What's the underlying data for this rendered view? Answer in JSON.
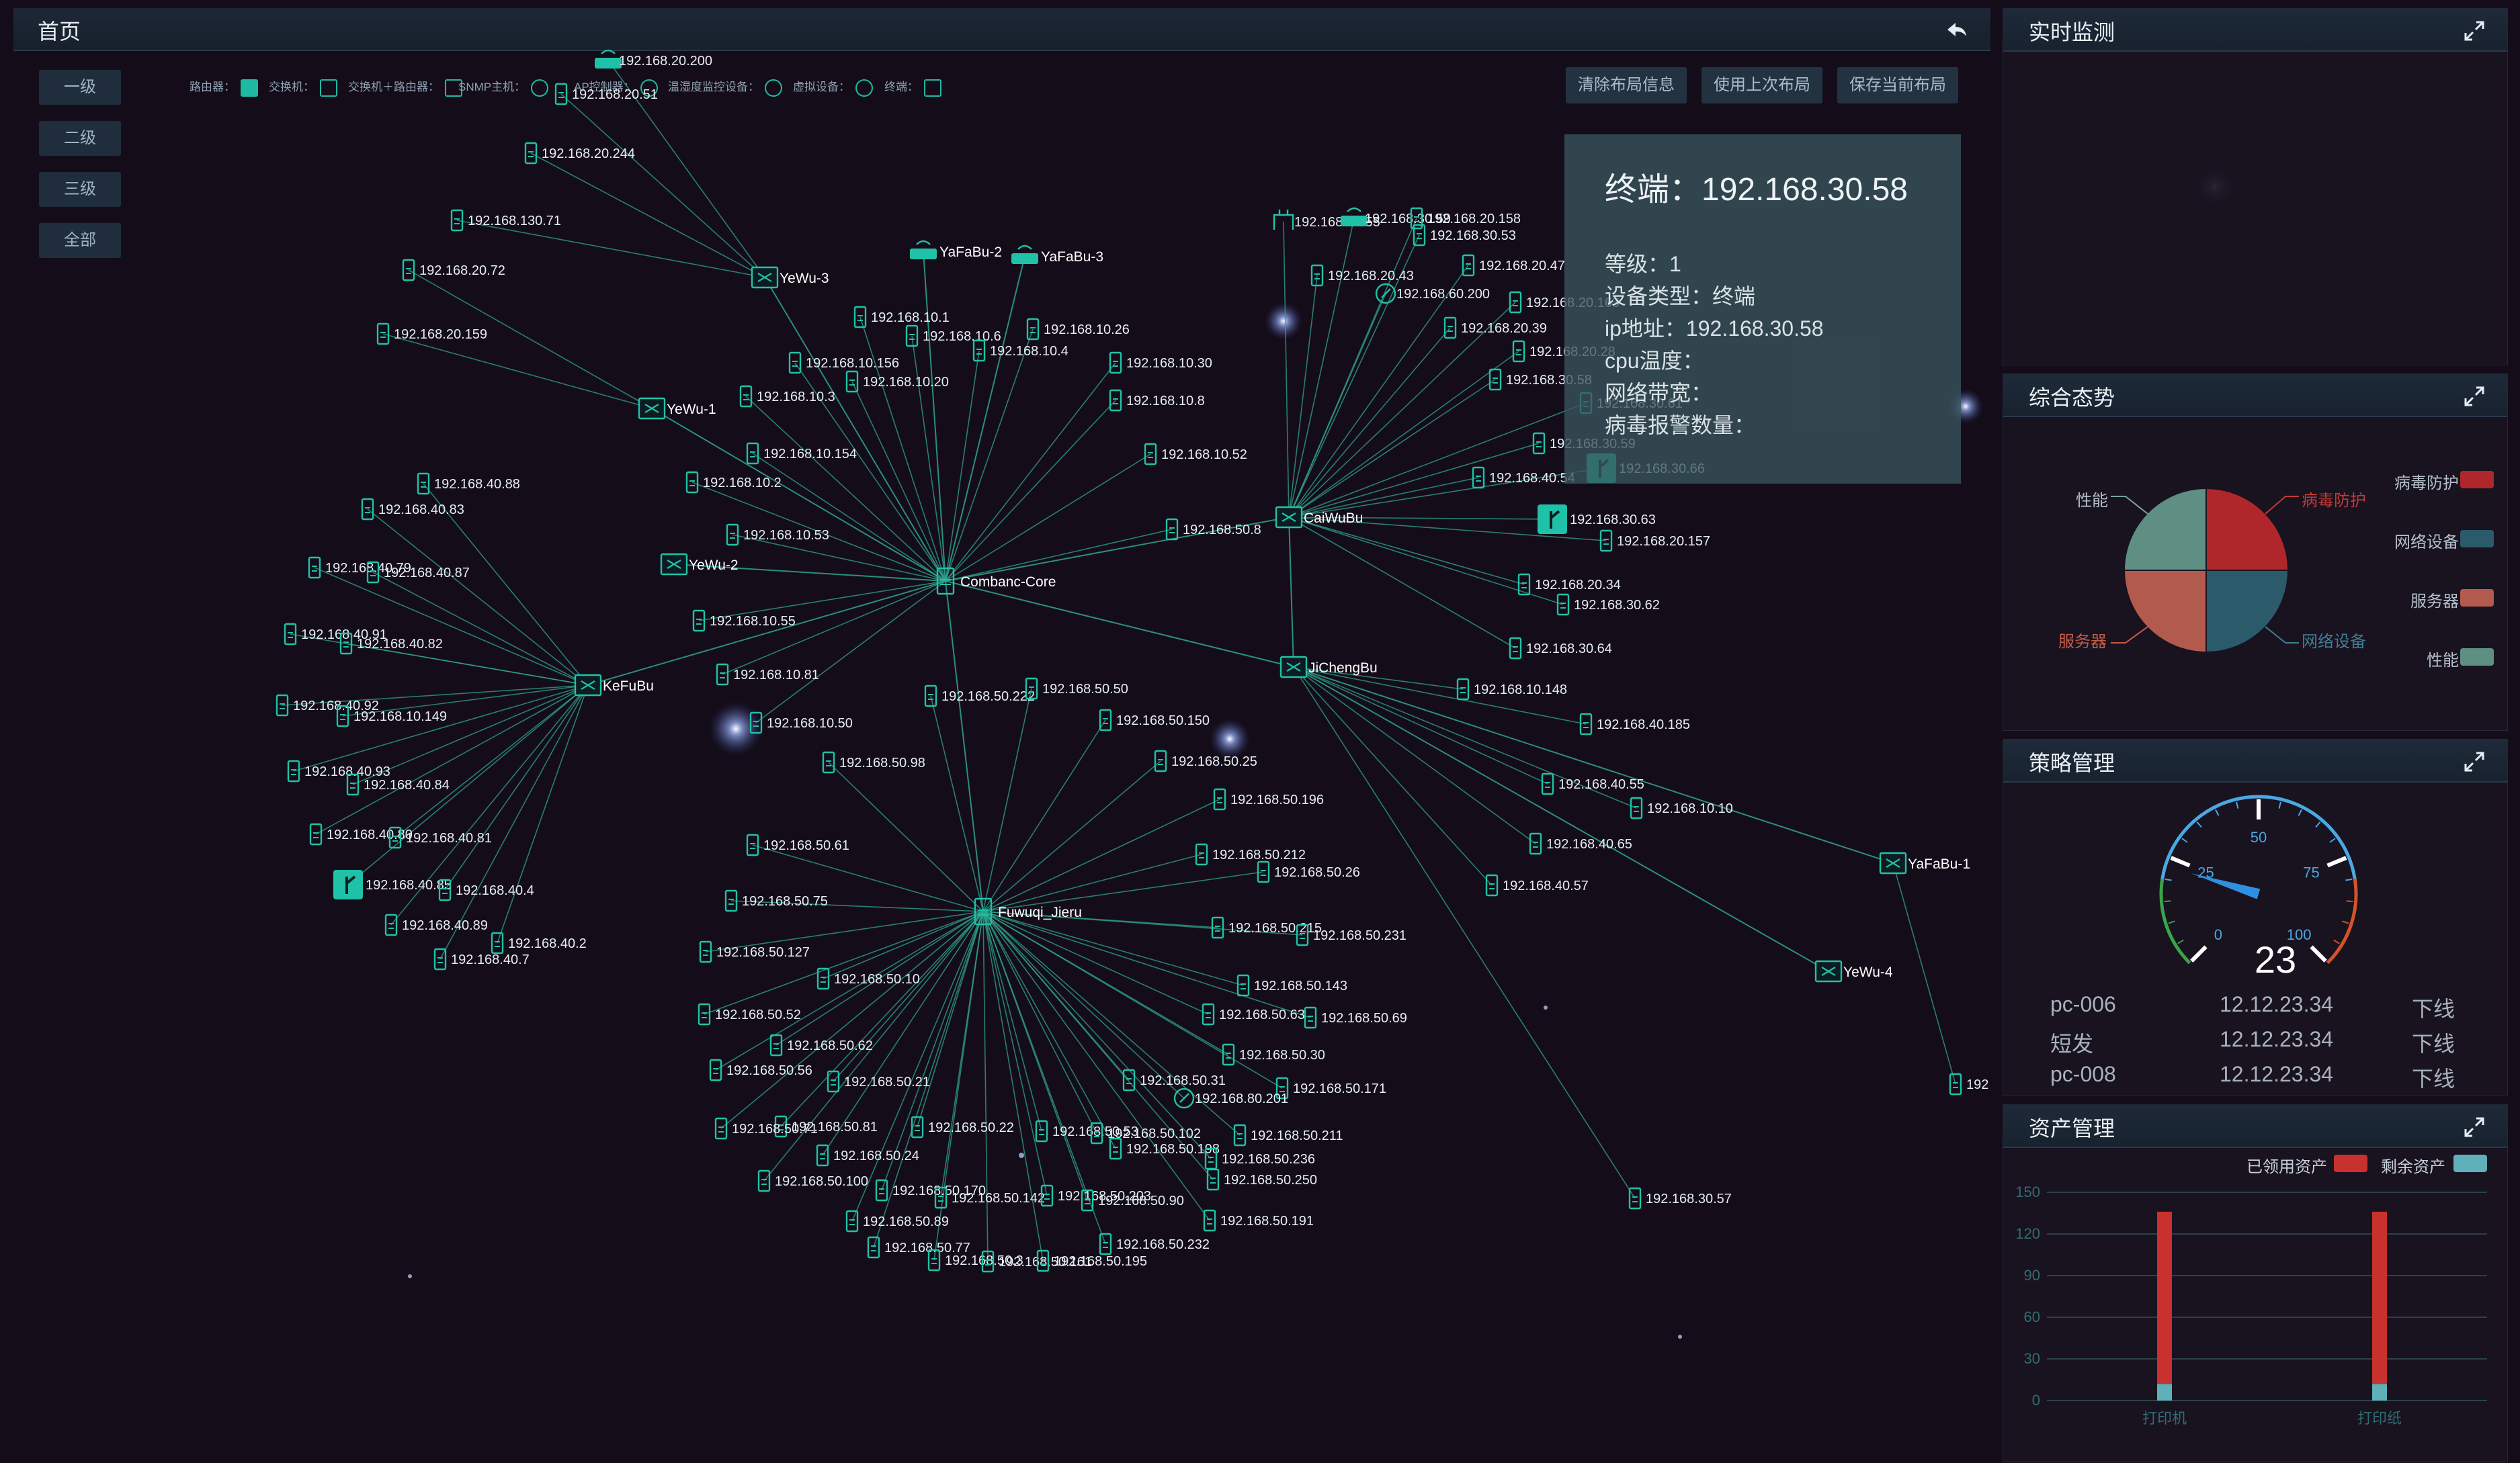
{
  "main": {
    "title": "首页",
    "levels": [
      "一级",
      "二级",
      "三级",
      "全部"
    ],
    "legend": [
      {
        "label": "路由器：",
        "icon": "router-icon"
      },
      {
        "label": "交换机：",
        "icon": "switch-icon"
      },
      {
        "label": "交换机＋路由器：",
        "icon": "switch-router-icon"
      },
      {
        "label": "SNMP主机：",
        "icon": "snmp-host-icon"
      },
      {
        "label": "AP控制器：",
        "icon": "ap-controller-icon"
      },
      {
        "label": "温湿度监控设备：",
        "icon": "thermo-monitor-icon"
      },
      {
        "label": "虚拟设备：",
        "icon": "virtual-device-icon"
      },
      {
        "label": "终端：",
        "icon": "terminal-icon"
      }
    ],
    "toolbar": {
      "clear_layout": "清除布局信息",
      "use_last_layout": "使用上次布局",
      "save_layout": "保存当前布局"
    },
    "tooltip": {
      "title": "终端：192.168.30.58",
      "level_label": "等级：",
      "level_value": "1",
      "type_label": "设备类型：",
      "type_value": "终端",
      "ip_label": "ip地址：",
      "ip_value": "192.168.30.58",
      "cpu_label": "cpu温度：",
      "bandwidth_label": "网络带宽：",
      "virus_label": "病毒报警数量："
    }
  },
  "topology": {
    "hubs": [
      {
        "id": "combanc",
        "label": "Combanc-Core",
        "kind": "server"
      },
      {
        "id": "fuwuqi",
        "label": "Fuwuqi_Jieru",
        "kind": "server"
      },
      {
        "id": "kefubu",
        "label": "KeFuBu",
        "kind": "switch"
      },
      {
        "id": "caiwubu",
        "label": "CaiWuBu",
        "kind": "switch"
      },
      {
        "id": "jichengbu",
        "label": "JiChengBu",
        "kind": "switch"
      },
      {
        "id": "yewu3",
        "label": "YeWu-3",
        "kind": "switch"
      },
      {
        "id": "yewu1",
        "label": "YeWu-1",
        "kind": "switch"
      },
      {
        "id": "yewu2",
        "label": "YeWu-2",
        "kind": "switch"
      },
      {
        "id": "yewu4",
        "label": "YeWu-4",
        "kind": "switch"
      },
      {
        "id": "yafabu1",
        "label": "YaFaBu-1",
        "kind": "switch"
      },
      {
        "id": "yafabu2",
        "label": "YaFaBu-2",
        "kind": "ap"
      },
      {
        "id": "yafabu3",
        "label": "YaFaBu-3",
        "kind": "ap"
      }
    ],
    "hub_links": [
      [
        "combanc",
        "fuwuqi"
      ],
      [
        "combanc",
        "kefubu"
      ],
      [
        "combanc",
        "caiwubu"
      ],
      [
        "combanc",
        "jichengbu"
      ],
      [
        "combanc",
        "yewu3"
      ],
      [
        "combanc",
        "yewu1"
      ],
      [
        "combanc",
        "yewu2"
      ],
      [
        "combanc",
        "yafabu2"
      ],
      [
        "combanc",
        "yafabu3"
      ],
      [
        "caiwubu",
        "jichengbu"
      ],
      [
        "jichengbu",
        "yafabu1"
      ],
      [
        "jichengbu",
        "yewu4"
      ]
    ],
    "nodes": [
      {
        "label": "192.168.20.200",
        "hub": "yewu3",
        "kind": "ap"
      },
      {
        "label": "192.168.20.51",
        "hub": "yewu3",
        "kind": "terminal"
      },
      {
        "label": "192.168.20.244",
        "hub": "yewu3",
        "kind": "terminal"
      },
      {
        "label": "192.168.130.71",
        "hub": "yewu3",
        "kind": "terminal"
      },
      {
        "label": "192.168.20.72",
        "hub": "yewu1",
        "kind": "terminal"
      },
      {
        "label": "192.168.20.159",
        "hub": "yewu1",
        "kind": "terminal"
      },
      {
        "label": "192.168.10.1",
        "hub": "combanc",
        "kind": "terminal"
      },
      {
        "label": "192.168.10.6",
        "hub": "combanc",
        "kind": "terminal"
      },
      {
        "label": "192.168.10.26",
        "hub": "combanc",
        "kind": "terminal"
      },
      {
        "label": "192.168.10.4",
        "hub": "combanc",
        "kind": "terminal"
      },
      {
        "label": "192.168.10.156",
        "hub": "combanc",
        "kind": "terminal"
      },
      {
        "label": "192.168.10.30",
        "hub": "combanc",
        "kind": "terminal"
      },
      {
        "label": "192.168.10.20",
        "hub": "combanc",
        "kind": "terminal"
      },
      {
        "label": "192.168.10.3",
        "hub": "combanc",
        "kind": "terminal"
      },
      {
        "label": "192.168.10.8",
        "hub": "combanc",
        "kind": "terminal"
      },
      {
        "label": "192.168.10.154",
        "hub": "combanc",
        "kind": "terminal"
      },
      {
        "label": "192.168.10.52",
        "hub": "combanc",
        "kind": "terminal"
      },
      {
        "label": "192.168.10.2",
        "hub": "combanc",
        "kind": "terminal"
      },
      {
        "label": "192.168.10.53",
        "hub": "combanc",
        "kind": "terminal"
      },
      {
        "label": "192.168.50.8",
        "hub": "combanc",
        "kind": "terminal"
      },
      {
        "label": "192.168.10.55",
        "hub": "combanc",
        "kind": "terminal"
      },
      {
        "label": "192.168.10.81",
        "hub": "combanc",
        "kind": "terminal"
      },
      {
        "label": "192.168.10.50",
        "hub": "combanc",
        "kind": "terminal"
      },
      {
        "label": "192.168.40.88",
        "hub": "kefubu",
        "kind": "terminal"
      },
      {
        "label": "192.168.40.83",
        "hub": "kefubu",
        "kind": "terminal"
      },
      {
        "label": "192.168.40.79",
        "hub": "kefubu",
        "kind": "terminal"
      },
      {
        "label": "192.168.40.87",
        "hub": "kefubu",
        "kind": "terminal"
      },
      {
        "label": "192.168.40.91",
        "hub": "kefubu",
        "kind": "terminal"
      },
      {
        "label": "192.168.40.82",
        "hub": "kefubu",
        "kind": "terminal"
      },
      {
        "label": "192.168.40.92",
        "hub": "kefubu",
        "kind": "terminal"
      },
      {
        "label": "192.168.10.149",
        "hub": "kefubu",
        "kind": "terminal"
      },
      {
        "label": "192.168.40.93",
        "hub": "kefubu",
        "kind": "terminal"
      },
      {
        "label": "192.168.40.84",
        "hub": "kefubu",
        "kind": "terminal"
      },
      {
        "label": "192.168.40.80",
        "hub": "kefubu",
        "kind": "terminal"
      },
      {
        "label": "192.168.40.81",
        "hub": "kefubu",
        "kind": "terminal"
      },
      {
        "label": "192.168.40.85",
        "hub": "kefubu",
        "kind": "router"
      },
      {
        "label": "192.168.40.4",
        "hub": "kefubu",
        "kind": "terminal"
      },
      {
        "label": "192.168.40.89",
        "hub": "kefubu",
        "kind": "terminal"
      },
      {
        "label": "192.168.40.2",
        "hub": "kefubu",
        "kind": "terminal"
      },
      {
        "label": "192.168.40.7",
        "hub": "kefubu",
        "kind": "terminal"
      },
      {
        "label": "192.168.30.55",
        "hub": "caiwubu",
        "kind": "snmp"
      },
      {
        "label": "192.168.30.59",
        "hub": "caiwubu",
        "kind": "ap"
      },
      {
        "label": "192.168.20.158",
        "hub": "caiwubu",
        "kind": "terminal"
      },
      {
        "label": "192.168.30.53",
        "hub": "caiwubu",
        "kind": "terminal"
      },
      {
        "label": "192.168.20.43",
        "hub": "caiwubu",
        "kind": "terminal"
      },
      {
        "label": "192.168.20.47",
        "hub": "caiwubu",
        "kind": "terminal"
      },
      {
        "label": "192.168.60.200",
        "hub": "caiwubu",
        "kind": "virtual"
      },
      {
        "label": "192.168.20.163",
        "hub": "caiwubu",
        "kind": "terminal"
      },
      {
        "label": "192.168.20.39",
        "hub": "caiwubu",
        "kind": "terminal"
      },
      {
        "label": "192.168.20.28",
        "hub": "caiwubu",
        "kind": "terminal"
      },
      {
        "label": "192.168.30.58",
        "hub": "caiwubu",
        "kind": "terminal"
      },
      {
        "label": "192.168.30.61",
        "hub": "caiwubu",
        "kind": "terminal"
      },
      {
        "label": "192.168.30.59",
        "hub": "caiwubu",
        "kind": "terminal"
      },
      {
        "label": "192.168.40.54",
        "hub": "caiwubu",
        "kind": "terminal"
      },
      {
        "label": "192.168.30.66",
        "hub": "caiwubu",
        "kind": "router"
      },
      {
        "label": "192.168.30.63",
        "hub": "caiwubu",
        "kind": "router"
      },
      {
        "label": "192.168.20.157",
        "hub": "caiwubu",
        "kind": "terminal"
      },
      {
        "label": "192.168.20.34",
        "hub": "caiwubu",
        "kind": "terminal"
      },
      {
        "label": "192.168.30.62",
        "hub": "caiwubu",
        "kind": "terminal"
      },
      {
        "label": "192.168.30.64",
        "hub": "caiwubu",
        "kind": "terminal"
      },
      {
        "label": "192.168.10.148",
        "hub": "jichengbu",
        "kind": "terminal"
      },
      {
        "label": "192.168.40.185",
        "hub": "jichengbu",
        "kind": "terminal"
      },
      {
        "label": "192.168.40.55",
        "hub": "jichengbu",
        "kind": "terminal"
      },
      {
        "label": "192.168.10.10",
        "hub": "jichengbu",
        "kind": "terminal"
      },
      {
        "label": "192.168.40.65",
        "hub": "jichengbu",
        "kind": "terminal"
      },
      {
        "label": "192.168.40.57",
        "hub": "jichengbu",
        "kind": "terminal"
      },
      {
        "label": "192.168.30.57",
        "hub": "jichengbu",
        "kind": "terminal"
      },
      {
        "label": "192",
        "hub": "yafabu1",
        "kind": "terminal"
      },
      {
        "label": "192.168.50.222",
        "hub": "fuwuqi",
        "kind": "terminal"
      },
      {
        "label": "192.168.50.50",
        "hub": "fuwuqi",
        "kind": "terminal"
      },
      {
        "label": "192.168.50.150",
        "hub": "fuwuqi",
        "kind": "terminal"
      },
      {
        "label": "192.168.50.98",
        "hub": "fuwuqi",
        "kind": "terminal"
      },
      {
        "label": "192.168.50.25",
        "hub": "fuwuqi",
        "kind": "terminal"
      },
      {
        "label": "192.168.50.196",
        "hub": "fuwuqi",
        "kind": "terminal"
      },
      {
        "label": "192.168.50.61",
        "hub": "fuwuqi",
        "kind": "terminal"
      },
      {
        "label": "192.168.50.212",
        "hub": "fuwuqi",
        "kind": "terminal"
      },
      {
        "label": "192.168.50.26",
        "hub": "fuwuqi",
        "kind": "terminal"
      },
      {
        "label": "192.168.50.75",
        "hub": "fuwuqi",
        "kind": "terminal"
      },
      {
        "label": "192.168.50.215",
        "hub": "fuwuqi",
        "kind": "terminal"
      },
      {
        "label": "192.168.50.231",
        "hub": "fuwuqi",
        "kind": "terminal"
      },
      {
        "label": "192.168.50.127",
        "hub": "fuwuqi",
        "kind": "terminal"
      },
      {
        "label": "192.168.50.10",
        "hub": "fuwuqi",
        "kind": "terminal"
      },
      {
        "label": "192.168.50.143",
        "hub": "fuwuqi",
        "kind": "terminal"
      },
      {
        "label": "192.168.50.52",
        "hub": "fuwuqi",
        "kind": "terminal"
      },
      {
        "label": "192.168.50.63",
        "hub": "fuwuqi",
        "kind": "terminal"
      },
      {
        "label": "192.168.50.69",
        "hub": "fuwuqi",
        "kind": "terminal"
      },
      {
        "label": "192.168.50.62",
        "hub": "fuwuqi",
        "kind": "terminal"
      },
      {
        "label": "192.168.50.56",
        "hub": "fuwuqi",
        "kind": "terminal"
      },
      {
        "label": "192.168.50.30",
        "hub": "fuwuqi",
        "kind": "terminal"
      },
      {
        "label": "192.168.50.21",
        "hub": "fuwuqi",
        "kind": "terminal"
      },
      {
        "label": "192.168.50.31",
        "hub": "fuwuqi",
        "kind": "terminal"
      },
      {
        "label": "192.168.50.171",
        "hub": "fuwuqi",
        "kind": "terminal"
      },
      {
        "label": "192.168.80.201",
        "hub": "fuwuqi",
        "kind": "virtual"
      },
      {
        "label": "192.168.50.81",
        "hub": "fuwuqi",
        "kind": "terminal"
      },
      {
        "label": "192.168.50.71",
        "hub": "fuwuqi",
        "kind": "terminal"
      },
      {
        "label": "192.168.50.22",
        "hub": "fuwuqi",
        "kind": "terminal"
      },
      {
        "label": "192.168.50.53",
        "hub": "fuwuqi",
        "kind": "terminal"
      },
      {
        "label": "192.168.50.102",
        "hub": "fuwuqi",
        "kind": "terminal"
      },
      {
        "label": "192.168.50.211",
        "hub": "fuwuqi",
        "kind": "terminal"
      },
      {
        "label": "192.168.50.24",
        "hub": "fuwuqi",
        "kind": "terminal"
      },
      {
        "label": "192.168.50.198",
        "hub": "fuwuqi",
        "kind": "terminal"
      },
      {
        "label": "192.168.50.236",
        "hub": "fuwuqi",
        "kind": "terminal"
      },
      {
        "label": "192.168.50.100",
        "hub": "fuwuqi",
        "kind": "terminal"
      },
      {
        "label": "192.168.50.170",
        "hub": "fuwuqi",
        "kind": "terminal"
      },
      {
        "label": "192.168.50.250",
        "hub": "fuwuqi",
        "kind": "terminal"
      },
      {
        "label": "192.168.50.142",
        "hub": "fuwuqi",
        "kind": "terminal"
      },
      {
        "label": "192.168.50.203",
        "hub": "fuwuqi",
        "kind": "terminal"
      },
      {
        "label": "192.168.50.90",
        "hub": "fuwuqi",
        "kind": "terminal"
      },
      {
        "label": "192.168.50.89",
        "hub": "fuwuqi",
        "kind": "terminal"
      },
      {
        "label": "192.168.50.191",
        "hub": "fuwuqi",
        "kind": "terminal"
      },
      {
        "label": "192.168.50.77",
        "hub": "fuwuqi",
        "kind": "terminal"
      },
      {
        "label": "192.168.50.232",
        "hub": "fuwuqi",
        "kind": "terminal"
      },
      {
        "label": "192.168.50.3",
        "hub": "fuwuqi",
        "kind": "terminal"
      },
      {
        "label": "192.168.50.161",
        "hub": "fuwuqi",
        "kind": "terminal"
      },
      {
        "label": "192.168.50.195",
        "hub": "fuwuqi",
        "kind": "terminal"
      }
    ]
  },
  "panels": {
    "monitor": {
      "title": "实时监测"
    },
    "situation": {
      "title": "综合态势",
      "slices": [
        {
          "label": "病毒防护",
          "value": 25,
          "color": "#b0272b"
        },
        {
          "label": "网络设备",
          "value": 25,
          "color": "#2b5a6b"
        },
        {
          "label": "服务器",
          "value": 25,
          "color": "#b35a4e"
        },
        {
          "label": "性能",
          "value": 25,
          "color": "#5f8f82"
        }
      ]
    },
    "strategy": {
      "title": "策略管理",
      "gauge": {
        "value": 23,
        "min": 0,
        "max": 100,
        "ticks": [
          "0",
          "25",
          "50",
          "75",
          "100"
        ]
      },
      "rows": [
        {
          "name": "pc-006",
          "time": "12.12.23.34",
          "status": "下线"
        },
        {
          "name": "短发",
          "time": "12.12.23.34",
          "status": "下线"
        },
        {
          "name": "pc-008",
          "time": "12.12.23.34",
          "status": "下线"
        }
      ]
    },
    "assets": {
      "title": "资产管理",
      "chart_data": {
        "type": "bar",
        "categories": [
          "打印机",
          "打印纸"
        ],
        "series": [
          {
            "name": "已领用资产",
            "values": [
              124,
              124
            ],
            "color": "#c8312d"
          },
          {
            "name": "剩余资产",
            "values": [
              12,
              12
            ],
            "color": "#5fb0b8"
          }
        ],
        "stacked": true,
        "ylim": [
          0,
          150
        ],
        "yticks": [
          "0",
          "30",
          "60",
          "90",
          "120",
          "150"
        ],
        "legend": "top-right"
      }
    }
  }
}
